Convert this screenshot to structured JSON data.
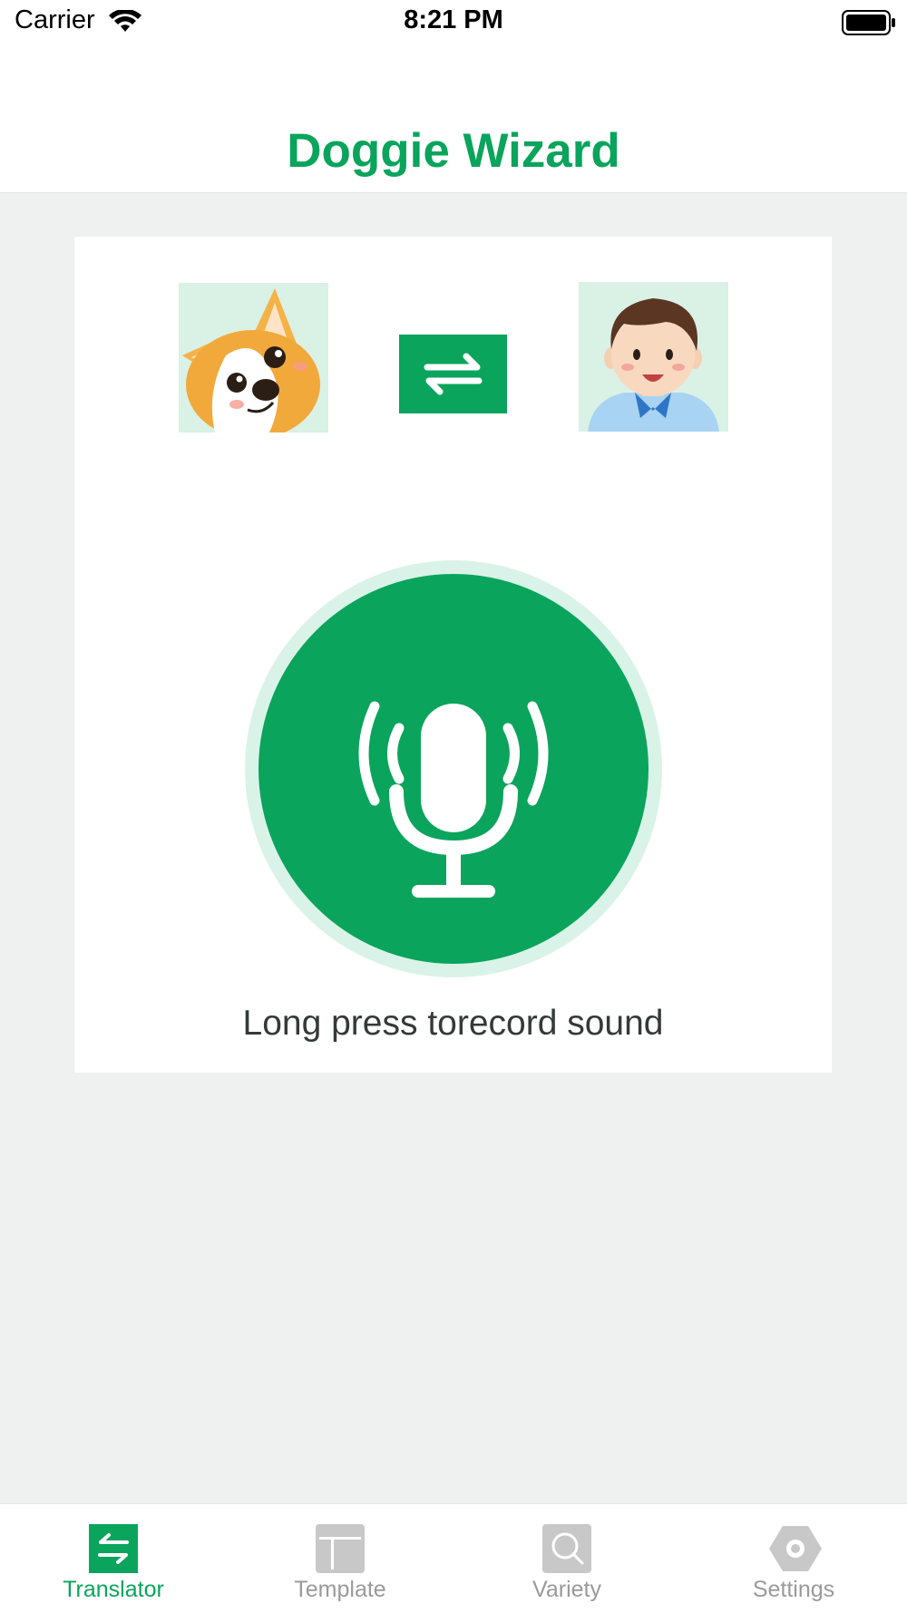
{
  "status_bar": {
    "carrier": "Carrier",
    "time": "8:21 PM"
  },
  "nav": {
    "title": "Doggie Wizard"
  },
  "translator": {
    "source_avatar_icon": "corgi-dog-avatar",
    "target_avatar_icon": "human-boy-avatar",
    "swap_icon": "swap-arrows-icon",
    "record_icon": "microphone-icon",
    "hint": "Long press torecord sound"
  },
  "tabs": [
    {
      "label": "Translator",
      "icon": "translate-icon",
      "active": true
    },
    {
      "label": "Template",
      "icon": "template-icon",
      "active": false
    },
    {
      "label": "Variety",
      "icon": "search-icon",
      "active": false
    },
    {
      "label": "Settings",
      "icon": "gear-icon",
      "active": false
    }
  ],
  "colors": {
    "accent": "#0aa45c",
    "accent_light": "#daf3e8",
    "background": "#eff1f0",
    "inactive": "#c8c8c8"
  }
}
